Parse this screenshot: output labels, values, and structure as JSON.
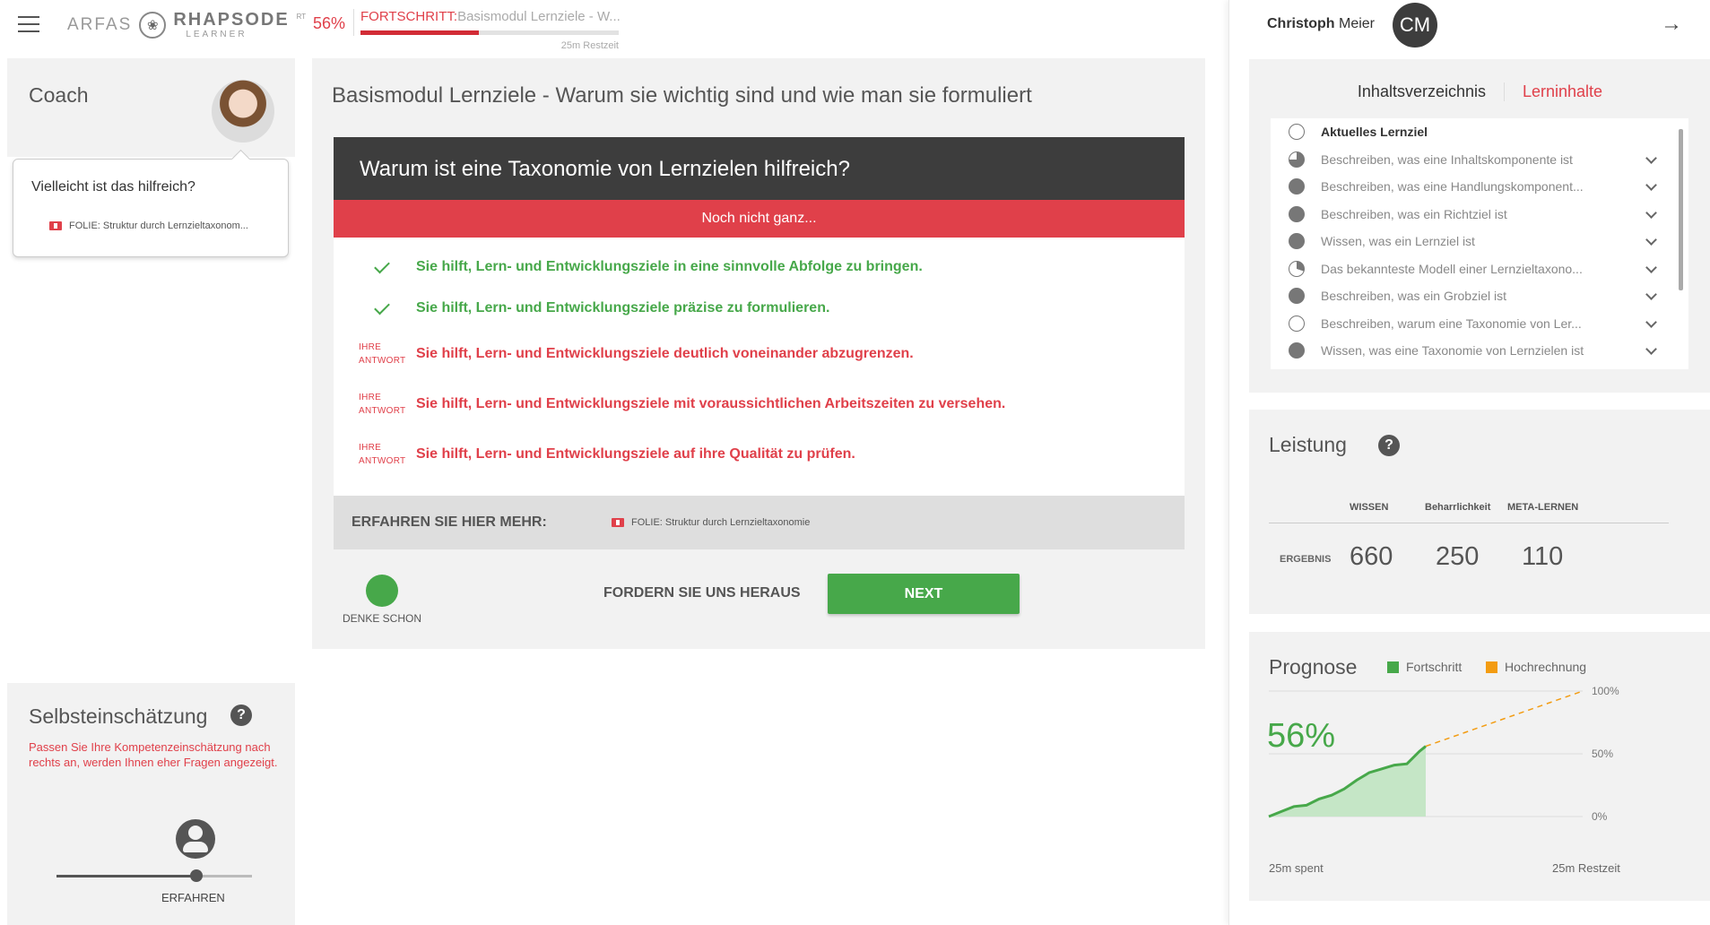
{
  "header": {
    "logo_arfas": "ARFAS",
    "logo_rhapsode": "RHAPSODE",
    "logo_learner": "LEARNER",
    "logo_tm": "RT",
    "progress_percent": "56%",
    "progress_fraction": 0.46,
    "progress_label": "FORTSCHRITT:",
    "progress_course": "Basismodul Lernziele - W...",
    "remaining": "25m Restzeit"
  },
  "coach": {
    "title": "Coach",
    "hint_question": "Vielleicht ist das hilfreich?",
    "hint_link": "FOLIE: Struktur durch Lernzieltaxonom..."
  },
  "selbst": {
    "title": "Selbsteinschätzung",
    "description": "Passen Sie Ihre Kompetenzeinschätzung nach rechts an, werden Ihnen eher Fragen angezeigt.",
    "level_label": "ERFAHREN",
    "slider_fraction": 0.7
  },
  "main": {
    "title": "Basismodul Lernziele - Warum sie wichtig sind und wie man sie formuliert",
    "question": "Warum ist eine Taxonomie von Lernzielen hilfreich?",
    "status": "Noch nicht ganz...",
    "answers": [
      {
        "type": "correct",
        "text": "Sie hilft, Lern- und Entwicklungsziele in eine sinnvolle Abfolge zu bringen."
      },
      {
        "type": "correct",
        "text": "Sie hilft, Lern- und Entwicklungsziele präzise zu formulieren."
      },
      {
        "type": "wrong",
        "tag1": "IHRE",
        "tag2": "ANTWORT",
        "text": "Sie hilft, Lern- und Entwicklungsziele deutlich voneinander abzugrenzen."
      },
      {
        "type": "wrong",
        "tag1": "IHRE",
        "tag2": "ANTWORT",
        "text": "Sie hilft, Lern- und Entwicklungsziele mit voraussichtlichen Arbeitszeiten zu versehen."
      },
      {
        "type": "wrong",
        "tag1": "IHRE",
        "tag2": "ANTWORT",
        "text": "Sie hilft, Lern- und Entwicklungsziele auf ihre Qualität zu prüfen."
      }
    ],
    "more_label": "ERFAHREN SIE HIER MEHR:",
    "more_link": "FOLIE: Struktur durch Lernzieltaxonomie",
    "denke_label": "DENKE SCHON",
    "challenge_label": "FORDERN SIE UNS HERAUS",
    "next_label": "NEXT"
  },
  "user": {
    "first_name": "Christoph",
    "last_name": "Meier",
    "initials": "CM"
  },
  "toc": {
    "tab_inactive": "Inhaltsverzeichnis",
    "tab_active": "Lerninhalte",
    "items": [
      {
        "label": "Aktuelles Lernziel",
        "state": "empty"
      },
      {
        "label": "Beschreiben, was eine Inhaltskomponente ist",
        "state": "three"
      },
      {
        "label": "Beschreiben, was eine Handlungskomponent...",
        "state": "full"
      },
      {
        "label": "Beschreiben, was ein Richtziel ist",
        "state": "full"
      },
      {
        "label": "Wissen, was ein Lernziel ist",
        "state": "full"
      },
      {
        "label": "Das bekannteste Modell einer Lernzieltaxono...",
        "state": "quarter"
      },
      {
        "label": "Beschreiben, was ein Grobziel ist",
        "state": "full"
      },
      {
        "label": "Beschreiben, warum eine Taxonomie von Ler...",
        "state": "empty"
      },
      {
        "label": "Wissen, was eine Taxonomie von Lernzielen ist",
        "state": "full"
      }
    ]
  },
  "leistung": {
    "title": "Leistung",
    "columns": [
      "WISSEN",
      "Beharrlichkeit",
      "META-LERNEN"
    ],
    "row_label": "ERGEBNIS",
    "values": [
      "660",
      "250",
      "110"
    ]
  },
  "prognose": {
    "title": "Prognose",
    "legend_progress": "Fortschritt",
    "legend_forecast": "Hochrechnung",
    "color_progress": "#47a84a",
    "color_forecast": "#f39c12",
    "big_percent": "56%",
    "x_start_label": "25m spent",
    "x_end_label": "25m Restzeit",
    "y_ticks": [
      "100%",
      "50%",
      "0%"
    ]
  },
  "chart_data": {
    "type": "area",
    "title": "Prognose",
    "xlabel": "",
    "ylabel": "",
    "ylim": [
      0,
      100
    ],
    "series": [
      {
        "name": "Fortschritt",
        "x": [
          0,
          2,
          4,
          6,
          8,
          10,
          12,
          14,
          16,
          18,
          20,
          22,
          24,
          25
        ],
        "values": [
          0,
          4,
          8,
          9,
          14,
          17,
          22,
          29,
          35,
          38,
          41,
          42,
          52,
          56
        ]
      },
      {
        "name": "Hochrechnung",
        "x": [
          25,
          50
        ],
        "values": [
          56,
          100
        ]
      }
    ],
    "x_tick_labels": [
      "25m spent",
      "25m Restzeit"
    ],
    "y_tick_labels": [
      "0%",
      "50%",
      "100%"
    ]
  }
}
